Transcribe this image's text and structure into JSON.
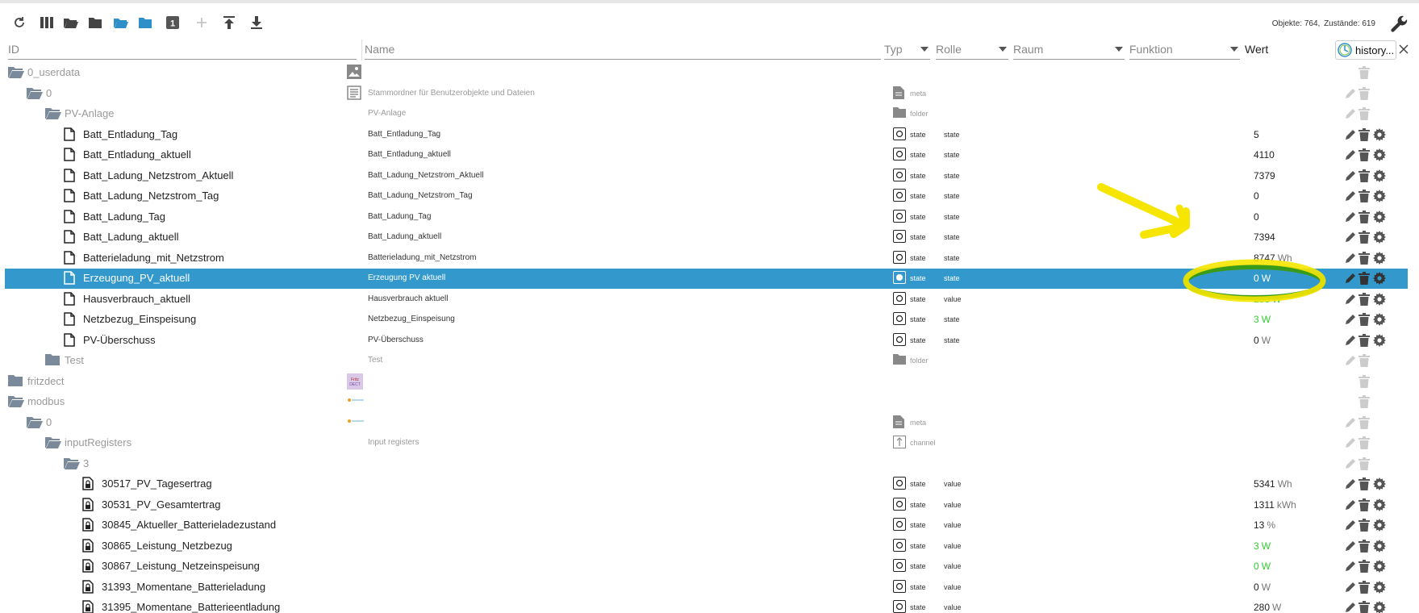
{
  "counts": {
    "objects_label": "Objekte: 764,",
    "states_label": "Zustände: 619"
  },
  "columns": {
    "id": "ID",
    "name": "Name",
    "type": "Typ",
    "role": "Rolle",
    "room": "Raum",
    "function": "Funktion",
    "value": "Wert",
    "history": "history..."
  },
  "toolbar_icons": [
    "refresh-icon",
    "columns-icon",
    "folder-open-icon",
    "folder-icon",
    "folder-open-blue-icon",
    "folder-blue-icon",
    "counter-1-icon",
    "add-icon",
    "upload-icon",
    "download-icon"
  ],
  "rows": [
    {
      "id": "0_userdata",
      "name": "",
      "type": "",
      "role": "",
      "value": "",
      "unit": "",
      "depth": 0,
      "kind": "folder-open",
      "muted": true,
      "namebox": "image",
      "typeicon": "",
      "acts": "trash-only"
    },
    {
      "id": "0",
      "name": "Stammordner für Benutzerobjekte und Dateien",
      "type": "meta",
      "role": "",
      "value": "",
      "unit": "",
      "depth": 1,
      "kind": "folder-open",
      "muted": true,
      "namebox": "doc",
      "typeicon": "meta",
      "acts": "edit-trash"
    },
    {
      "id": "PV-Anlage",
      "name": "PV-Anlage",
      "type": "folder",
      "role": "",
      "value": "",
      "unit": "",
      "depth": 2,
      "kind": "folder-open",
      "muted": true,
      "namebox": "",
      "typeicon": "folder",
      "acts": "edit-trash"
    },
    {
      "id": "Batt_Entladung_Tag",
      "name": "Batt_Entladung_Tag",
      "type": "state",
      "role": "state",
      "value": "5",
      "unit": "",
      "depth": 3,
      "kind": "file",
      "muted": false,
      "namebox": "",
      "typeicon": "state",
      "acts": "all"
    },
    {
      "id": "Batt_Entladung_aktuell",
      "name": "Batt_Entladung_aktuell",
      "type": "state",
      "role": "state",
      "value": "4110",
      "unit": "",
      "depth": 3,
      "kind": "file",
      "muted": false,
      "namebox": "",
      "typeicon": "state",
      "acts": "all"
    },
    {
      "id": "Batt_Ladung_Netzstrom_Aktuell",
      "name": "Batt_Ladung_Netzstrom_Aktuell",
      "type": "state",
      "role": "state",
      "value": "7379",
      "unit": "",
      "depth": 3,
      "kind": "file",
      "muted": false,
      "namebox": "",
      "typeicon": "state",
      "acts": "all"
    },
    {
      "id": "Batt_Ladung_Netzstrom_Tag",
      "name": "Batt_Ladung_Netzstrom_Tag",
      "type": "state",
      "role": "state",
      "value": "0",
      "unit": "",
      "depth": 3,
      "kind": "file",
      "muted": false,
      "namebox": "",
      "typeicon": "state",
      "acts": "all"
    },
    {
      "id": "Batt_Ladung_Tag",
      "name": "Batt_Ladung_Tag",
      "type": "state",
      "role": "state",
      "value": "0",
      "unit": "",
      "depth": 3,
      "kind": "file",
      "muted": false,
      "namebox": "",
      "typeicon": "state",
      "acts": "all"
    },
    {
      "id": "Batt_Ladung_aktuell",
      "name": "Batt_Ladung_aktuell",
      "type": "state",
      "role": "state",
      "value": "7394",
      "unit": "",
      "depth": 3,
      "kind": "file",
      "muted": false,
      "namebox": "",
      "typeicon": "state",
      "acts": "all"
    },
    {
      "id": "Batterieladung_mit_Netzstrom",
      "name": "Batterieladung_mit_Netzstrom",
      "type": "state",
      "role": "state",
      "value": "8747",
      "unit": "Wh",
      "depth": 3,
      "kind": "file",
      "muted": false,
      "namebox": "",
      "typeicon": "state",
      "acts": "all"
    },
    {
      "id": "Erzeugung_PV_aktuell",
      "name": "Erzeugung PV aktuell",
      "type": "state",
      "role": "state",
      "value": "0",
      "unit": "W",
      "depth": 3,
      "kind": "file",
      "muted": false,
      "selected": true,
      "namebox": "",
      "typeicon": "state",
      "acts": "all"
    },
    {
      "id": "Hausverbrauch_aktuell",
      "name": "Hausverbrauch aktuell",
      "type": "state",
      "role": "value",
      "value": "283",
      "unit": "W",
      "depth": 3,
      "kind": "file",
      "muted": false,
      "green": true,
      "namebox": "",
      "typeicon": "state",
      "acts": "all"
    },
    {
      "id": "Netzbezug_Einspeisung",
      "name": "Netzbezug_Einspeisung",
      "type": "state",
      "role": "state",
      "value": "3",
      "unit": "W",
      "depth": 3,
      "kind": "file",
      "muted": false,
      "green": true,
      "namebox": "",
      "typeicon": "state",
      "acts": "all"
    },
    {
      "id": "PV-Überschuss",
      "name": "PV-Überschuss",
      "type": "state",
      "role": "state",
      "value": "0",
      "unit": "W",
      "depth": 3,
      "kind": "file",
      "muted": false,
      "namebox": "",
      "typeicon": "state",
      "acts": "all"
    },
    {
      "id": "Test",
      "name": "Test",
      "type": "folder",
      "role": "",
      "value": "",
      "unit": "",
      "depth": 2,
      "kind": "folder",
      "muted": true,
      "namebox": "",
      "typeicon": "folder",
      "acts": "edit-trash"
    },
    {
      "id": "fritzdect",
      "name": "",
      "type": "",
      "role": "",
      "value": "",
      "unit": "",
      "depth": 0,
      "kind": "folder",
      "muted": true,
      "namebox": "fritz",
      "typeicon": "",
      "acts": "trash-only"
    },
    {
      "id": "modbus",
      "name": "",
      "type": "",
      "role": "",
      "value": "",
      "unit": "",
      "depth": 0,
      "kind": "folder-open",
      "muted": true,
      "namebox": "modbus",
      "typeicon": "",
      "acts": "trash-only"
    },
    {
      "id": "0",
      "name": "",
      "type": "meta",
      "role": "",
      "value": "",
      "unit": "",
      "depth": 1,
      "kind": "folder-open",
      "muted": true,
      "namebox": "modbus",
      "typeicon": "meta",
      "acts": "edit-trash"
    },
    {
      "id": "inputRegisters",
      "name": "Input registers",
      "type": "channel",
      "role": "",
      "value": "",
      "unit": "",
      "depth": 2,
      "kind": "folder-open",
      "muted": true,
      "namebox": "",
      "typeicon": "channel",
      "acts": "edit-trash"
    },
    {
      "id": "3",
      "name": "",
      "type": "",
      "role": "",
      "value": "",
      "unit": "",
      "depth": 3,
      "kind": "folder-open",
      "muted": true,
      "namebox": "",
      "typeicon": "",
      "acts": "edit-trash"
    },
    {
      "id": "30517_PV_Tagesertrag",
      "name": "",
      "type": "state",
      "role": "value",
      "value": "5341",
      "unit": "Wh",
      "depth": 4,
      "kind": "lockfile",
      "muted": false,
      "namebox": "",
      "typeicon": "state",
      "acts": "all"
    },
    {
      "id": "30531_PV_Gesamtertrag",
      "name": "",
      "type": "state",
      "role": "value",
      "value": "1311",
      "unit": "kWh",
      "depth": 4,
      "kind": "lockfile",
      "muted": false,
      "namebox": "",
      "typeicon": "state",
      "acts": "all"
    },
    {
      "id": "30845_Aktueller_Batterieladezustand",
      "name": "",
      "type": "state",
      "role": "value",
      "value": "13",
      "unit": "%",
      "depth": 4,
      "kind": "lockfile",
      "muted": false,
      "namebox": "",
      "typeicon": "state",
      "acts": "all"
    },
    {
      "id": "30865_Leistung_Netzbezug",
      "name": "",
      "type": "state",
      "role": "value",
      "value": "3",
      "unit": "W",
      "depth": 4,
      "kind": "lockfile",
      "muted": false,
      "green": true,
      "namebox": "",
      "typeicon": "state",
      "acts": "all"
    },
    {
      "id": "30867_Leistung_Netzeinspeisung",
      "name": "",
      "type": "state",
      "role": "value",
      "value": "0",
      "unit": "W",
      "depth": 4,
      "kind": "lockfile",
      "muted": false,
      "green": true,
      "namebox": "",
      "typeicon": "state",
      "acts": "all"
    },
    {
      "id": "31393_Momentane_Batterieladung",
      "name": "",
      "type": "state",
      "role": "value",
      "value": "0",
      "unit": "W",
      "depth": 4,
      "kind": "lockfile",
      "muted": false,
      "namebox": "",
      "typeicon": "state",
      "acts": "all"
    },
    {
      "id": "31395_Momentane_Batterieentladung",
      "name": "",
      "type": "state",
      "role": "value",
      "value": "280",
      "unit": "W",
      "depth": 4,
      "kind": "lockfile",
      "muted": false,
      "namebox": "",
      "typeicon": "state",
      "acts": "all"
    }
  ],
  "colors": {
    "selected_row": "#3399cc",
    "accent_blue": "#2e8fc9",
    "green_value": "#33cc33",
    "icon_gray": "#7a8a9a",
    "annotation_yellow": "#f5e500",
    "annotation_green": "#3a9a1a"
  }
}
